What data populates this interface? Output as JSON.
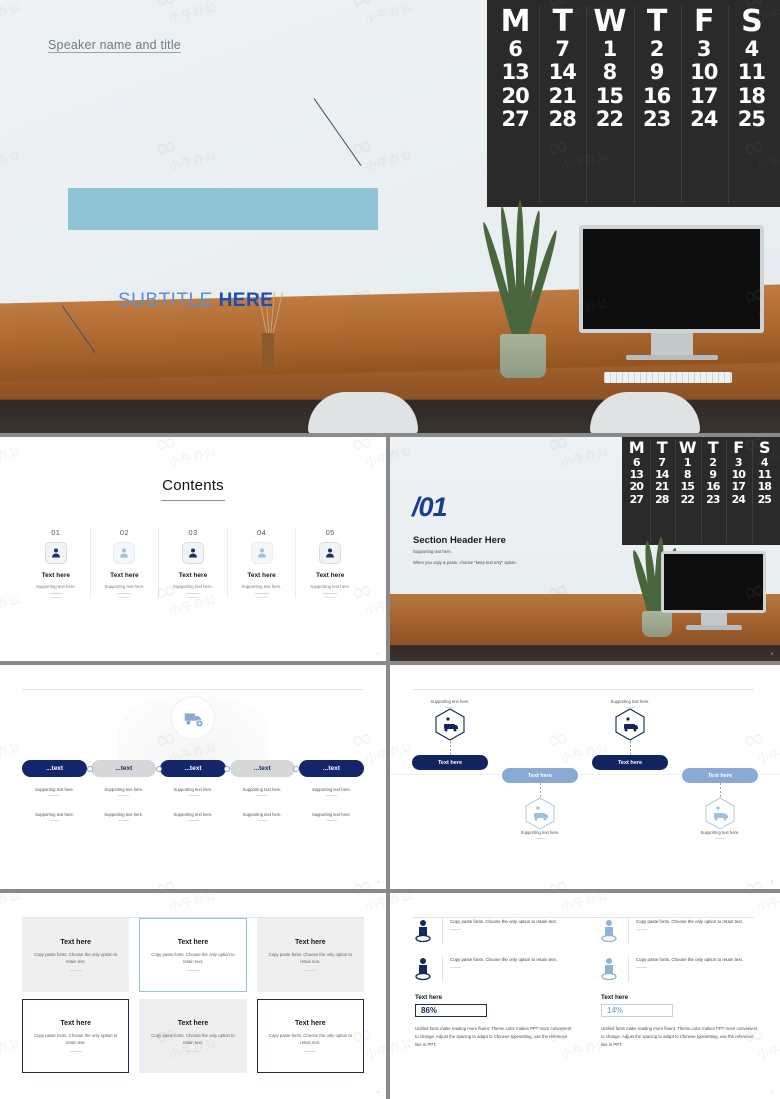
{
  "slide1": {
    "speaker": "Speaker name and title",
    "subtitle_light": "SUBTITLE ",
    "subtitle_bold": "HERE",
    "calendar": {
      "headers": [
        "M",
        "T",
        "W",
        "T",
        "F",
        "S"
      ],
      "columns": [
        [
          "6",
          "13",
          "20",
          "27"
        ],
        [
          "7",
          "14",
          "21",
          "28"
        ],
        [
          "1",
          "8",
          "15",
          "22"
        ],
        [
          "2",
          "9",
          "16",
          "23"
        ],
        [
          "3",
          "10",
          "17",
          "24"
        ],
        [
          "4",
          "11",
          "18",
          "25"
        ]
      ]
    }
  },
  "slide2": {
    "title": "Contents",
    "page_number": "2",
    "items": [
      {
        "num": "01",
        "label": "Text here",
        "sub": "Supporting text here.",
        "icon": "user-icon",
        "tone": "dark"
      },
      {
        "num": "02",
        "label": "Text here",
        "sub": "Supporting text here.",
        "icon": "user-hand-icon",
        "tone": "light"
      },
      {
        "num": "03",
        "label": "Text here",
        "sub": "Supporting text here.",
        "icon": "user-check-icon",
        "tone": "dark"
      },
      {
        "num": "04",
        "label": "Text here",
        "sub": "Supporting text here.",
        "icon": "user-question-icon",
        "tone": "light"
      },
      {
        "num": "05",
        "label": "Text here",
        "sub": "Supporting text here.",
        "icon": "user-search-icon",
        "tone": "dark"
      }
    ]
  },
  "slide3": {
    "number": "/01",
    "header": "Section Header Here",
    "support1": "Supporting text here.",
    "support2": "When you copy & paste, choose \"keep text only\" option.",
    "page_number": "3",
    "calendar": {
      "headers": [
        "M",
        "T",
        "W",
        "T",
        "F",
        "S"
      ],
      "columns": [
        [
          "6",
          "13",
          "20",
          "27"
        ],
        [
          "7",
          "14",
          "21",
          "28"
        ],
        [
          "1",
          "8",
          "15",
          "22"
        ],
        [
          "2",
          "9",
          "16",
          "23"
        ],
        [
          "3",
          "10",
          "17",
          "24"
        ],
        [
          "4",
          "11",
          "18",
          "25"
        ]
      ]
    }
  },
  "slide4": {
    "page_number": "4",
    "icon": "truck-add-icon",
    "pills": [
      {
        "label": "...text",
        "tone": "navy"
      },
      {
        "label": "...text",
        "tone": "grey"
      },
      {
        "label": "...text",
        "tone": "navy"
      },
      {
        "label": "...text",
        "tone": "grey"
      },
      {
        "label": "...text",
        "tone": "navy"
      }
    ],
    "row1": [
      "Supporting text here.",
      "Supporting text here.",
      "Supporting text here.",
      "Supporting text here.",
      "Supporting text here."
    ],
    "row2": [
      "Supporting text here.",
      "Supporting text here.",
      "Supporting text here.",
      "Supporting text here.",
      "Supporting text here."
    ]
  },
  "slide5": {
    "page_number": "5",
    "nodes": [
      {
        "label": "Text here",
        "tone": "navy",
        "support": "Supporting text here.",
        "position": "above",
        "icon": "hex-car-icon"
      },
      {
        "label": "Text here",
        "tone": "light",
        "support": "Supporting text here.",
        "position": "below",
        "icon": "hex-car-icon"
      },
      {
        "label": "Text here",
        "tone": "navy",
        "support": "Supporting text here.",
        "position": "above",
        "icon": "hex-car-icon"
      },
      {
        "label": "Text here",
        "tone": "light",
        "support": "Supporting text here.",
        "position": "below",
        "icon": "hex-car-icon"
      }
    ]
  },
  "slide6": {
    "page_number": "6",
    "cards": [
      {
        "title": "Text here",
        "body": "Copy paste fonts. Choose the only option to retain text.",
        "style": "grey"
      },
      {
        "title": "Text here",
        "body": "Copy paste fonts. Choose the only option to retain text.",
        "style": "blue"
      },
      {
        "title": "Text here",
        "body": "Copy paste fonts. Choose the only option to retain text.",
        "style": "grey"
      },
      {
        "title": "Text here",
        "body": "Copy paste fonts. Choose the only option to retain text.",
        "style": "navy"
      },
      {
        "title": "Text here",
        "body": "Copy paste fonts. Choose the only option to retain text.",
        "style": "grey"
      },
      {
        "title": "Text here",
        "body": "Copy paste fonts. Choose the only option to retain text.",
        "style": "navy"
      }
    ]
  },
  "slide7": {
    "page_number": "7",
    "left": {
      "items": [
        {
          "text": "Copy paste fonts. Choose the only option to retain text.",
          "icon": "person-pin-icon",
          "tone": "dark"
        },
        {
          "text": "Copy paste fonts. Choose the only option to retain text.",
          "icon": "person-pin-icon",
          "tone": "dark"
        }
      ],
      "label": "Text here",
      "value": "86%",
      "paragraph": "Unified fonts make reading more fluent. Theme color makes PPT more convenient to change. Adjust the spacing to adapt to Chinese typesetting, use the reference line in PPT."
    },
    "right": {
      "items": [
        {
          "text": "Copy paste fonts. Choose the only option to retain text.",
          "icon": "person-pin-icon",
          "tone": "light"
        },
        {
          "text": "Copy paste fonts. Choose the only option to retain text.",
          "icon": "person-pin-icon",
          "tone": "light"
        }
      ],
      "label": "Text here",
      "value": "14%",
      "paragraph": "Unified fonts make reading more fluent. Theme color makes PPT more convenient to change. Adjust the spacing to adapt to Chinese typesetting, use the reference line in PPT."
    }
  },
  "colors": {
    "navy": "#15256b",
    "navy_dark": "#12245f",
    "light_blue": "#8aa9d4",
    "teal_bar": "#8fc4d5",
    "accent_blue": "#1a4fb5",
    "grey_pill": "#d6d7d9",
    "card_grey": "#efeff0"
  }
}
